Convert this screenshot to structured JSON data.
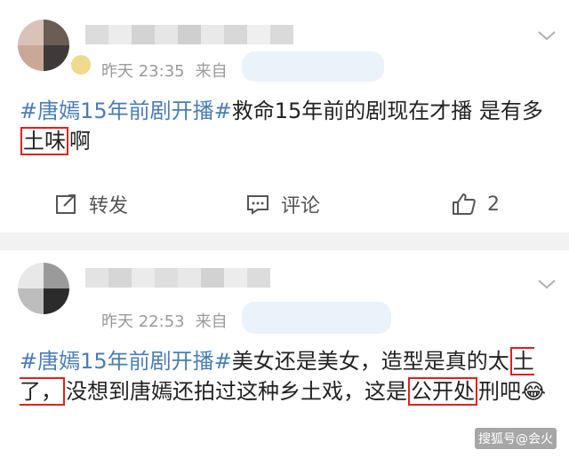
{
  "posts": [
    {
      "time": "昨天 23:35",
      "source": "来自",
      "hashtag": "#唐嫣15年前剧开播#",
      "text_a": "救命15年前的剧现在才播 是有多",
      "text_hl": "土味",
      "text_b": "啊",
      "actions": {
        "repost": "转发",
        "comment": "评论",
        "like_count": "2"
      }
    },
    {
      "time": "昨天 22:53",
      "source": "来自",
      "hashtag": "#唐嫣15年前剧开播#",
      "text_a": "美女还是美女，造型是真的太",
      "text_hl1": "土了，",
      "text_b": "没想到唐嫣还拍过这种乡土戏，这是",
      "text_hl2": "公开处",
      "text_c": "刑吧",
      "emoji": "😂"
    }
  ],
  "watermark": "搜狐号@会火",
  "icons": [
    "chevron-down-icon",
    "repost-icon",
    "comment-icon",
    "like-icon",
    "laughing-emoji"
  ],
  "colors": {
    "hashtag": "#4a7db5",
    "highlight_box": "#e02020",
    "meta": "#9a9a9a",
    "divider": "#f2f2f2"
  }
}
